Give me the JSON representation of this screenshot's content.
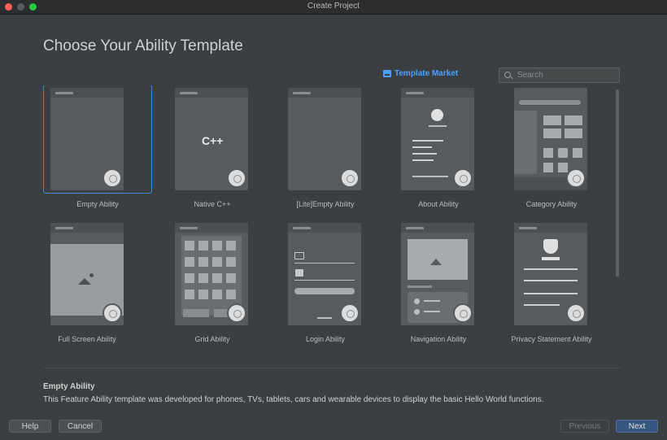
{
  "window": {
    "title": "Create Project"
  },
  "page": {
    "heading": "Choose Your Ability Template"
  },
  "market": {
    "label": "Template Market"
  },
  "search": {
    "placeholder": "Search"
  },
  "templates": [
    {
      "label": "Empty Ability",
      "selected": true
    },
    {
      "label": "Native C++"
    },
    {
      "label": "[Lite]Empty Ability"
    },
    {
      "label": "About Ability"
    },
    {
      "label": "Category Ability"
    },
    {
      "label": "Full Screen Ability"
    },
    {
      "label": "Grid Ability"
    },
    {
      "label": "Login Ability"
    },
    {
      "label": "Navigation Ability"
    },
    {
      "label": "Privacy Statement Ability"
    }
  ],
  "native_cpp": {
    "glyph": "C++"
  },
  "description": {
    "title": "Empty Ability",
    "text": "This Feature Ability template was developed for phones, TVs, tablets, cars and wearable devices to display the basic Hello World functions."
  },
  "buttons": {
    "help": "Help",
    "cancel": "Cancel",
    "previous": "Previous",
    "next": "Next"
  },
  "colors": {
    "accent": "#4aa1ff",
    "selection": "#3f8fe8",
    "primary_button": "#365880"
  }
}
